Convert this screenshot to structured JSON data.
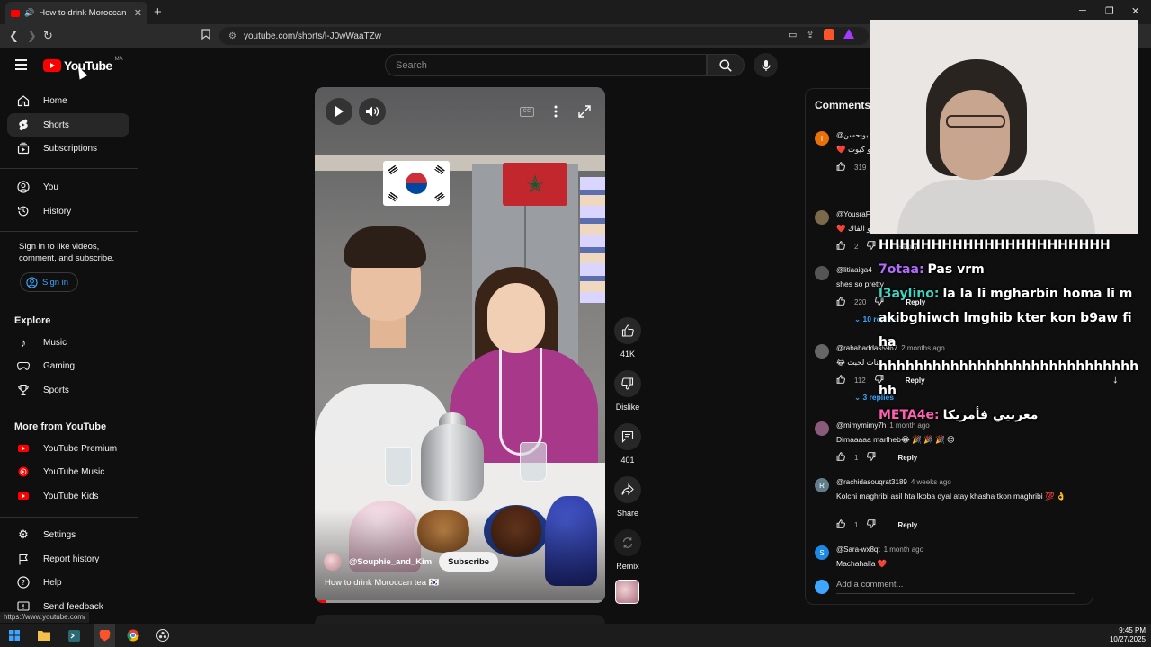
{
  "browser": {
    "tab_title": "How to drink Moroccan tea 🇰🇷",
    "url": "youtube.com/shorts/l-J0wWaaTZw",
    "status_url": "https://www.youtube.com/"
  },
  "header": {
    "logo_text": "YouTube",
    "region": "MA",
    "search_placeholder": "Search"
  },
  "sidebar": {
    "primary": [
      {
        "label": "Home",
        "icon": "home-icon"
      },
      {
        "label": "Shorts",
        "icon": "shorts-icon",
        "active": true
      },
      {
        "label": "Subscriptions",
        "icon": "subscriptions-icon"
      }
    ],
    "you": [
      {
        "label": "You",
        "icon": "user-icon"
      },
      {
        "label": "History",
        "icon": "history-icon"
      }
    ],
    "signin_prompt": "Sign in to like videos, comment, and subscribe.",
    "signin_label": "Sign in",
    "explore_title": "Explore",
    "explore": [
      {
        "label": "Music",
        "icon": "music-icon"
      },
      {
        "label": "Gaming",
        "icon": "gaming-icon"
      },
      {
        "label": "Sports",
        "icon": "trophy-icon"
      }
    ],
    "more_title": "More from YouTube",
    "more": [
      {
        "label": "YouTube Premium"
      },
      {
        "label": "YouTube Music"
      },
      {
        "label": "YouTube Kids"
      }
    ],
    "footer": [
      {
        "label": "Settings",
        "icon": "gear-icon"
      },
      {
        "label": "Report history",
        "icon": "flag-icon"
      },
      {
        "label": "Help",
        "icon": "help-icon"
      },
      {
        "label": "Send feedback",
        "icon": "feedback-icon"
      }
    ]
  },
  "video": {
    "channel": "@Souphie_and_Kim",
    "subscribe_label": "Subscribe",
    "title": "How to drink Moroccan tea 🇰🇷",
    "progress": 0.04
  },
  "actions": {
    "likes": "41K",
    "dislike_label": "Dislike",
    "comments": "401",
    "share_label": "Share",
    "remix_label": "Remix"
  },
  "comments_panel": {
    "title": "Comments",
    "add_placeholder": "Add a comment...",
    "reply_label": "Reply",
    "items": [
      {
        "author": "@بو-حسن",
        "ago": "",
        "text": "❤️ أو كيوت",
        "likes": "319",
        "avatar_letter": "I",
        "avatar_color": "#e8710a"
      },
      {
        "author": "@YousraF",
        "ago": "",
        "text": "❤️ أو الفاك",
        "likes": "2",
        "avatar_letter": "",
        "avatar_color": "#7a6a4a"
      },
      {
        "author": "@litiaaiga4",
        "ago": "",
        "text": "shes so pretty",
        "likes": "220",
        "replies": "10 replies",
        "avatar_letter": "",
        "avatar_color": "#555555"
      },
      {
        "author": "@rababaddas5967",
        "ago": "2 months ago",
        "text": "😂 بنات لحبت",
        "likes": "112",
        "replies": "3 replies",
        "avatar_letter": "",
        "avatar_color": "#666666"
      },
      {
        "author": "@mimymimy7h",
        "ago": "1 month ago",
        "text": "Dimaaaaa marlheb😂 🎉 🎉 🎉 😊",
        "likes": "1",
        "avatar_letter": "",
        "avatar_color": "#8a5a7a"
      },
      {
        "author": "@rachidasouqrat3189",
        "ago": "4 weeks ago",
        "text": "Kolchi maghribi asil hta lkoba dyal atay khasha tkon maghribi 💯 👌",
        "likes": "1",
        "avatar_letter": "R",
        "avatar_color": "#607d8b"
      },
      {
        "author": "@Sara-wx8qt",
        "ago": "1 month ago",
        "text": "Machahalla ❤️",
        "likes": "",
        "avatar_letter": "S",
        "avatar_color": "#1e88e5"
      }
    ]
  },
  "chat": [
    {
      "nick": "",
      "color": "#ffffff",
      "text": "HHHHHHHHHHHHHHHHHHHHHH"
    },
    {
      "nick": "7otaa:",
      "color": "#b36bff",
      "text": "Pas vrm"
    },
    {
      "nick": "l3aylino:",
      "color": "#3dd6c4",
      "text": "la la li mgharbin homa li makibghiwch lmghib kter kon b9aw fiha"
    },
    {
      "nick": "",
      "color": "#ffffff",
      "text": "hhhhhhhhhhhhhhhhhhhhhhhhhhhhhhh"
    },
    {
      "nick": "META4e:",
      "color": "#ff5fb0",
      "text": "معربيي فأمريكا"
    }
  ],
  "taskbar": {
    "time": "9:45 PM",
    "date": "10/27/2025"
  },
  "colors": {
    "brand_red": "#ff0000",
    "link_blue": "#3ea6ff",
    "background": "#0f0f0f"
  }
}
